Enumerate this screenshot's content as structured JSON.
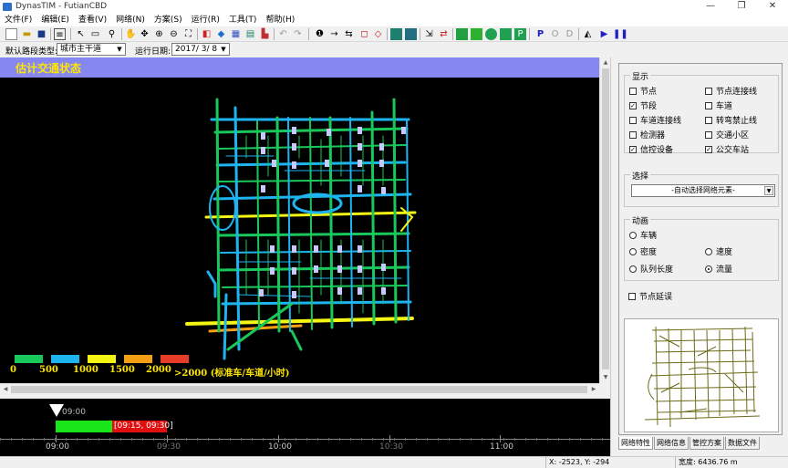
{
  "window": {
    "title": "DynasTIM - FutianCBD",
    "min_glyph": "—",
    "max_glyph": "❐",
    "close_glyph": "✕"
  },
  "menu": [
    "文件(F)",
    "编辑(E)",
    "查看(V)",
    "网络(N)",
    "方案(S)",
    "运行(R)",
    "工具(T)",
    "帮助(H)"
  ],
  "selectors": {
    "road_type_label": "默认路段类型:",
    "road_type_value": "城市主干道",
    "date_label": "运行日期:",
    "date_value": "2017/ 3/ 8"
  },
  "map": {
    "header": "估计交通状态",
    "background": "#000000",
    "legend": [
      {
        "label": "0",
        "color": "#19c85a"
      },
      {
        "label": "500",
        "color": "#1eb4f0"
      },
      {
        "label": "1000",
        "color": "#f5f514"
      },
      {
        "label": "1500",
        "color": "#f5a014"
      },
      {
        "label": "2000",
        "color": "#e63c28"
      }
    ],
    "legend_tail": ">2000 (标准车/车道/小时)"
  },
  "timeline": {
    "current_time": "09:00",
    "range_label": "[09:15, 09:30]",
    "ticks": [
      {
        "label": "09:00",
        "dim": false
      },
      {
        "label": "09:30",
        "dim": true
      },
      {
        "label": "10:00",
        "dim": false
      },
      {
        "label": "10:30",
        "dim": true
      },
      {
        "label": "11:00",
        "dim": false
      }
    ]
  },
  "panel": {
    "display_title": "显示",
    "display_items": [
      {
        "label": "节点",
        "checked": false
      },
      {
        "label": "节点连接线",
        "checked": false
      },
      {
        "label": "节段",
        "checked": true
      },
      {
        "label": "车道",
        "checked": false
      },
      {
        "label": "车道连接线",
        "checked": false
      },
      {
        "label": "转弯禁止线",
        "checked": false
      },
      {
        "label": "检测器",
        "checked": false
      },
      {
        "label": "交通小区",
        "checked": false
      },
      {
        "label": "信控设备",
        "checked": true
      },
      {
        "label": "公交车站",
        "checked": true
      }
    ],
    "select_title": "选择",
    "select_value": "-自动选择网络元素-",
    "anim_title": "动画",
    "anim_items": [
      {
        "label": "车辆",
        "checked": false
      },
      {
        "label": "密度",
        "checked": false
      },
      {
        "label": "速度",
        "checked": false
      },
      {
        "label": "队列长度",
        "checked": false
      },
      {
        "label": "流量",
        "checked": true
      }
    ],
    "node_delay": {
      "label": "节点延误",
      "checked": false
    },
    "tabs": [
      "网络特性",
      "网络信息",
      "管控方案",
      "数据文件"
    ]
  },
  "status": {
    "coords": "X: -2523, Y: -294",
    "width": "宽度: 6436.76 m"
  }
}
